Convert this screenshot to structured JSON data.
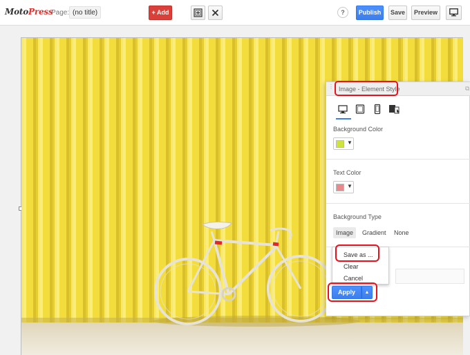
{
  "topbar": {
    "logo_part1": "Moto",
    "logo_part2": "Press",
    "page_label": "Page:",
    "page_title": "(no title)",
    "add_label": "+ Add",
    "help_label": "?",
    "publish_label": "Publish",
    "save_label": "Save",
    "preview_label": "Preview"
  },
  "panel": {
    "title": "Image - Element Style",
    "devices": [
      "desktop-icon",
      "tablet-icon",
      "mobile-icon",
      "responsive-icon"
    ],
    "background_color_label": "Background Color",
    "background_color": "#cfe33f",
    "text_color_label": "Text Color",
    "text_color": "#e88a8c",
    "background_type_label": "Background Type",
    "background_types": [
      "Image",
      "Gradient",
      "None"
    ],
    "swatch_caret": "▼"
  },
  "dropdown": {
    "items": [
      "Save as ...",
      "Clear",
      "Cancel"
    ]
  },
  "apply": {
    "label": "Apply",
    "caret": "▲"
  },
  "colors": {
    "accent_blue": "#3f7ee8",
    "add_red": "#d9403a",
    "highlight_red": "#e8111b",
    "photo_yellow": "#f2dc3a"
  }
}
